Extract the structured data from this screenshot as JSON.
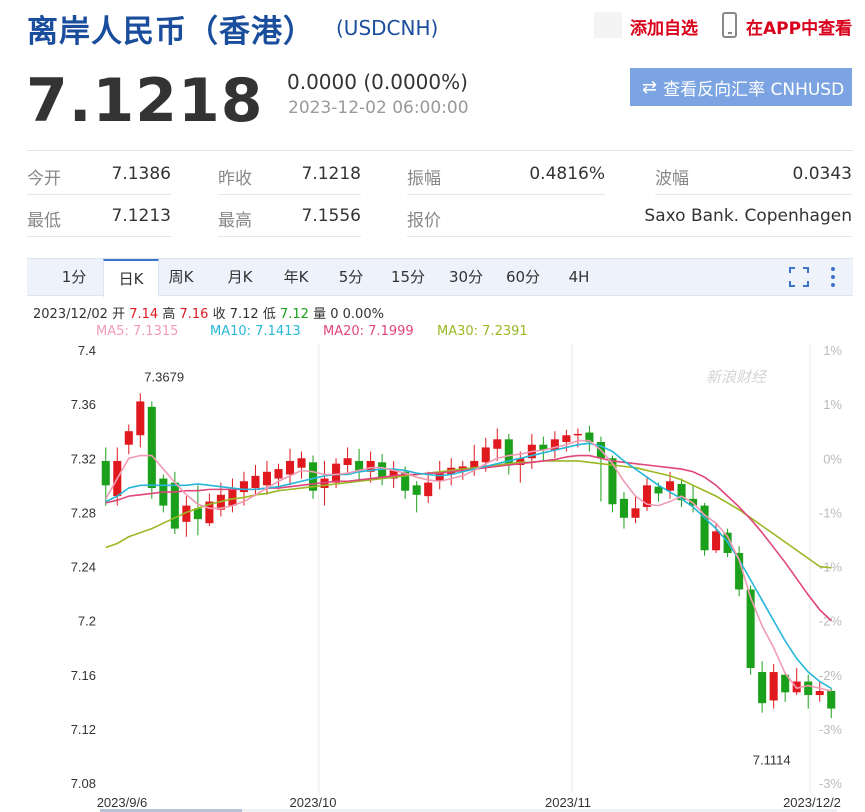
{
  "header": {
    "title": "离岸人民币（香港）",
    "symbol": "(USDCNH)",
    "add_favorite": "添加自选",
    "view_in_app": "在APP中查看"
  },
  "quote": {
    "price": "7.1218",
    "change": "0.0000 (0.0000%)",
    "time": "2023-12-02 06:00:00",
    "reverse_button": "查看反向汇率 CNHUSD"
  },
  "stats": {
    "open_label": "今开",
    "open": "7.1386",
    "prev_close_label": "昨收",
    "prev_close": "7.1218",
    "amplitude_label": "振幅",
    "amplitude": "0.4816%",
    "volatility_label": "波幅",
    "volatility": "0.0343",
    "low_label": "最低",
    "low": "7.1213",
    "high_label": "最高",
    "high": "7.1556",
    "quote_src_label": "报价",
    "quote_src": "Saxo Bank. Copenhagen"
  },
  "tabs": [
    "1分",
    "日K",
    "周K",
    "月K",
    "年K",
    "5分",
    "15分",
    "30分",
    "60分",
    "4H"
  ],
  "active_tab": "日K",
  "ohlc_line": {
    "date": "2023/12/02",
    "open_label": "开",
    "open": "7.14",
    "high_label": "高",
    "high": "7.16",
    "close_label": "收",
    "close": "7.12",
    "low_label": "低",
    "low": "7.12",
    "vol_label": "量",
    "vol": "0",
    "pct": "0.00%"
  },
  "ma": {
    "ma5": "MA5: 7.1315",
    "ma10": "MA10: 7.1413",
    "ma20": "MA20: 7.1999",
    "ma30": "MA30: 7.2391"
  },
  "colors": {
    "up": "#e0191f",
    "down": "#1aa01a",
    "ma5": "#f29bb5",
    "ma10": "#27b7d8",
    "ma20": "#e0457b",
    "ma30": "#9ab823",
    "title_blue": "#1a4e9c",
    "button": "#7ca4e2"
  },
  "watermark": "新浪财经",
  "chart_data": {
    "type": "candlestick",
    "ylim": [
      7.08,
      7.4
    ],
    "y_ticks": [
      "7.4",
      "7.36",
      "7.32",
      "7.28",
      "7.24",
      "7.2",
      "7.16",
      "7.12",
      "7.08"
    ],
    "y_tick_values": [
      7.4,
      7.36,
      7.32,
      7.28,
      7.24,
      7.2,
      7.16,
      7.12,
      7.08
    ],
    "pct_ticks": [
      "1%",
      "1%",
      "0%",
      "-1%",
      "-1%",
      "-2%",
      "-2%",
      "-3%",
      "-3%"
    ],
    "pct_tick_values": [
      7.4,
      7.36,
      7.32,
      7.28,
      7.24,
      7.2,
      7.16,
      7.12,
      7.08
    ],
    "x_labels": [
      {
        "index": 0,
        "text": "2023/9/6"
      },
      {
        "index": 19,
        "text": "2023/10"
      },
      {
        "index": 41,
        "text": "2023/11"
      },
      {
        "index": 63,
        "text": "2023/12/2"
      }
    ],
    "annotations": [
      {
        "index": 3,
        "value": 7.3679,
        "text": "7.3679"
      },
      {
        "index": 58,
        "value": 7.1114,
        "text": "7.1114"
      }
    ],
    "candles": [
      [
        7.318,
        7.3,
        7.328,
        7.285
      ],
      [
        7.292,
        7.318,
        7.328,
        7.285
      ],
      [
        7.33,
        7.34,
        7.345,
        7.323
      ],
      [
        7.337,
        7.362,
        7.368,
        7.328
      ],
      [
        7.358,
        7.298,
        7.362,
        7.29
      ],
      [
        7.305,
        7.285,
        7.308,
        7.28
      ],
      [
        7.302,
        7.268,
        7.31,
        7.264
      ],
      [
        7.273,
        7.285,
        7.292,
        7.262
      ],
      [
        7.283,
        7.275,
        7.3,
        7.263
      ],
      [
        7.272,
        7.288,
        7.294,
        7.27
      ],
      [
        7.282,
        7.293,
        7.302,
        7.277
      ],
      [
        7.285,
        7.297,
        7.305,
        7.28
      ],
      [
        7.295,
        7.303,
        7.31,
        7.285
      ],
      [
        7.298,
        7.307,
        7.315,
        7.292
      ],
      [
        7.3,
        7.31,
        7.318,
        7.293
      ],
      [
        7.305,
        7.312,
        7.316,
        7.297
      ],
      [
        7.308,
        7.318,
        7.327,
        7.3
      ],
      [
        7.313,
        7.32,
        7.325,
        7.305
      ],
      [
        7.317,
        7.296,
        7.322,
        7.29
      ],
      [
        7.298,
        7.305,
        7.318,
        7.285
      ],
      [
        7.302,
        7.316,
        7.32,
        7.298
      ],
      [
        7.315,
        7.32,
        7.328,
        7.308
      ],
      [
        7.318,
        7.31,
        7.327,
        7.303
      ],
      [
        7.31,
        7.318,
        7.325,
        7.302
      ],
      [
        7.317,
        7.305,
        7.323,
        7.3
      ],
      [
        7.305,
        7.312,
        7.318,
        7.298
      ],
      [
        7.31,
        7.296,
        7.314,
        7.29
      ],
      [
        7.3,
        7.293,
        7.303,
        7.28
      ],
      [
        7.292,
        7.302,
        7.31,
        7.287
      ],
      [
        7.303,
        7.31,
        7.318,
        7.297
      ],
      [
        7.308,
        7.313,
        7.32,
        7.3
      ],
      [
        7.311,
        7.314,
        7.318,
        7.304
      ],
      [
        7.312,
        7.318,
        7.33,
        7.307
      ],
      [
        7.317,
        7.328,
        7.335,
        7.31
      ],
      [
        7.327,
        7.334,
        7.342,
        7.318
      ],
      [
        7.334,
        7.316,
        7.338,
        7.308
      ],
      [
        7.315,
        7.32,
        7.325,
        7.302
      ],
      [
        7.32,
        7.33,
        7.338,
        7.312
      ],
      [
        7.33,
        7.326,
        7.336,
        7.318
      ],
      [
        7.326,
        7.334,
        7.34,
        7.32
      ],
      [
        7.332,
        7.337,
        7.341,
        7.325
      ],
      [
        7.337,
        7.338,
        7.342,
        7.328
      ],
      [
        7.339,
        7.332,
        7.344,
        7.325
      ],
      [
        7.332,
        7.32,
        7.336,
        7.288
      ],
      [
        7.32,
        7.286,
        7.322,
        7.28
      ],
      [
        7.29,
        7.276,
        7.295,
        7.268
      ],
      [
        7.276,
        7.283,
        7.292,
        7.272
      ],
      [
        7.284,
        7.3,
        7.306,
        7.281
      ],
      [
        7.299,
        7.294,
        7.302,
        7.288
      ],
      [
        7.296,
        7.303,
        7.31,
        7.29
      ],
      [
        7.301,
        7.289,
        7.305,
        7.284
      ],
      [
        7.29,
        7.285,
        7.3,
        7.28
      ],
      [
        7.285,
        7.252,
        7.287,
        7.248
      ],
      [
        7.252,
        7.266,
        7.272,
        7.25
      ],
      [
        7.265,
        7.25,
        7.268,
        7.247
      ],
      [
        7.25,
        7.223,
        7.255,
        7.218
      ],
      [
        7.223,
        7.165,
        7.226,
        7.16
      ],
      [
        7.162,
        7.139,
        7.17,
        7.132
      ],
      [
        7.141,
        7.162,
        7.168,
        7.135
      ],
      [
        7.16,
        7.147,
        7.162,
        7.14
      ],
      [
        7.147,
        7.155,
        7.165,
        7.145
      ],
      [
        7.155,
        7.145,
        7.16,
        7.135
      ],
      [
        7.145,
        7.148,
        7.155,
        7.14
      ],
      [
        7.148,
        7.135,
        7.15,
        7.128
      ]
    ],
    "ma5": [
      7.29,
      7.305,
      7.32,
      7.322,
      7.322,
      7.312,
      7.302,
      7.293,
      7.286,
      7.283,
      7.283,
      7.285,
      7.288,
      7.293,
      7.298,
      7.303,
      7.307,
      7.311,
      7.31,
      7.308,
      7.308,
      7.309,
      7.311,
      7.313,
      7.313,
      7.311,
      7.309,
      7.306,
      7.304,
      7.303,
      7.305,
      7.307,
      7.311,
      7.316,
      7.32,
      7.322,
      7.323,
      7.325,
      7.326,
      7.328,
      7.33,
      7.333,
      7.333,
      7.326,
      7.316,
      7.303,
      7.292,
      7.286,
      7.285,
      7.288,
      7.292,
      7.287,
      7.278,
      7.272,
      7.262,
      7.245,
      7.217,
      7.196,
      7.18,
      7.161,
      7.15,
      7.152,
      7.15,
      7.148
    ],
    "ma10": [
      7.288,
      7.292,
      7.298,
      7.3,
      7.3,
      7.3,
      7.3,
      7.3,
      7.301,
      7.3,
      7.299,
      7.298,
      7.297,
      7.297,
      7.298,
      7.299,
      7.301,
      7.303,
      7.305,
      7.307,
      7.308,
      7.308,
      7.31,
      7.311,
      7.312,
      7.312,
      7.311,
      7.309,
      7.308,
      7.307,
      7.308,
      7.31,
      7.312,
      7.314,
      7.316,
      7.318,
      7.32,
      7.322,
      7.324,
      7.326,
      7.328,
      7.33,
      7.331,
      7.329,
      7.325,
      7.318,
      7.312,
      7.306,
      7.3,
      7.295,
      7.29,
      7.284,
      7.276,
      7.268,
      7.258,
      7.245,
      7.23,
      7.215,
      7.2,
      7.185,
      7.172,
      7.162,
      7.155,
      7.15
    ],
    "ma20": [
      7.287,
      7.289,
      7.292,
      7.293,
      7.294,
      7.295,
      7.295,
      7.296,
      7.296,
      7.297,
      7.297,
      7.297,
      7.297,
      7.297,
      7.298,
      7.298,
      7.299,
      7.3,
      7.301,
      7.302,
      7.303,
      7.303,
      7.304,
      7.305,
      7.306,
      7.307,
      7.308,
      7.308,
      7.309,
      7.309,
      7.31,
      7.311,
      7.312,
      7.313,
      7.314,
      7.315,
      7.316,
      7.317,
      7.318,
      7.319,
      7.321,
      7.322,
      7.322,
      7.32,
      7.318,
      7.317,
      7.316,
      7.315,
      7.314,
      7.313,
      7.312,
      7.31,
      7.306,
      7.3,
      7.292,
      7.284,
      7.275,
      7.265,
      7.254,
      7.243,
      7.231,
      7.219,
      7.208,
      7.2
    ],
    "ma30": [
      7.254,
      7.257,
      7.262,
      7.265,
      7.268,
      7.272,
      7.276,
      7.28,
      7.283,
      7.286,
      7.288,
      7.29,
      7.291,
      7.293,
      7.294,
      7.296,
      7.297,
      7.298,
      7.299,
      7.3,
      7.301,
      7.302,
      7.303,
      7.304,
      7.305,
      7.306,
      7.307,
      7.308,
      7.309,
      7.31,
      7.311,
      7.312,
      7.313,
      7.314,
      7.315,
      7.316,
      7.317,
      7.317,
      7.318,
      7.318,
      7.318,
      7.318,
      7.317,
      7.316,
      7.315,
      7.314,
      7.313,
      7.311,
      7.309,
      7.307,
      7.304,
      7.3,
      7.296,
      7.292,
      7.287,
      7.282,
      7.276,
      7.27,
      7.264,
      7.258,
      7.252,
      7.246,
      7.24,
      7.239
    ]
  }
}
